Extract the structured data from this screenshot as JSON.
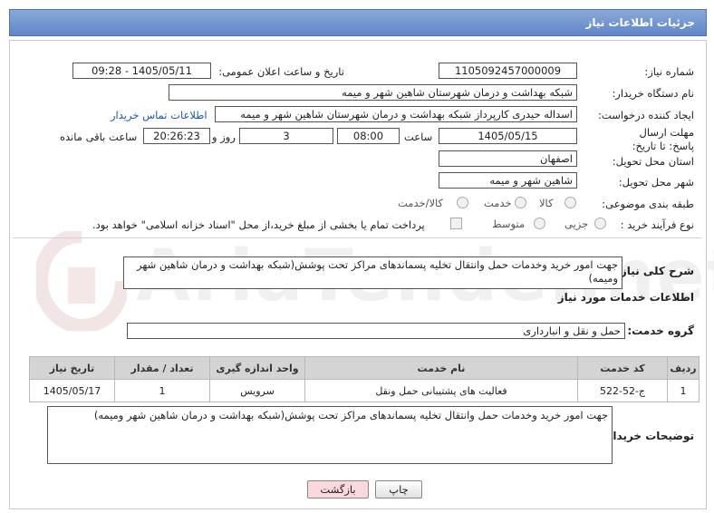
{
  "header": {
    "title": "جزئیات اطلاعات نیاز"
  },
  "fields": {
    "need_number_label": "شماره نیاز:",
    "need_number": "1105092457000009",
    "announce_label": "تاریخ و ساعت اعلان عمومی:",
    "announce_value": "1405/05/11 - 09:28",
    "buyer_org_label": "نام دستگاه خریدار:",
    "buyer_org": "شبکه بهداشت و درمان شهرستان شاهین شهر و میمه",
    "creator_label": "ایجاد کننده درخواست:",
    "creator": "اسداله حیدری کارپرداز شبکه بهداشت و درمان شهرستان شاهین شهر و میمه",
    "contact_link": "اطلاعات تماس خریدار",
    "deadline_label": "مهلت ارسال پاسخ: تا تاریخ:",
    "deadline_date": "1405/05/15",
    "time_label": "ساعت",
    "deadline_time": "08:00",
    "days_value": "3",
    "days_label": "روز و",
    "remaining_time": "20:26:23",
    "remaining_label": "ساعت باقی مانده",
    "province_label": "استان محل تحویل:",
    "province": "اصفهان",
    "city_label": "شهر محل تحویل:",
    "city": "شاهین شهر و میمه",
    "category_label": "طبقه بندی موضوعی:",
    "category_options": [
      "کالا",
      "خدمت",
      "کالا/خدمت"
    ],
    "process_label": "نوع فرآیند خرید :",
    "process_options": [
      "جزیی",
      "متوسط"
    ],
    "payment_note": "پرداخت تمام یا بخشی از مبلغ خرید،از محل \"اسناد خزانه اسلامی\" خواهد بود."
  },
  "summary": {
    "label": "شرح کلی نیاز:",
    "text": "جهت امور خرید وخدمات حمل وانتقال تخلیه پسماندهای مراکز تحت پوشش(شبکه بهداشت و درمان شاهین شهر ومیمه)"
  },
  "services": {
    "section_title": "اطلاعات خدمات مورد نیاز",
    "group_label": "گروه خدمت:",
    "group_value": "حمل و نقل و انبارداری",
    "columns": [
      "ردیف",
      "کد خدمت",
      "نام خدمت",
      "واحد اندازه گیری",
      "تعداد / مقدار",
      "تاریخ نیاز"
    ],
    "rows": [
      [
        "1",
        "ج-52-522",
        "فعالیت های پشتیبانی حمل ونقل",
        "سرویس",
        "1",
        "1405/05/17"
      ]
    ]
  },
  "buyer_notes": {
    "label": "توضیحات خریدار:",
    "text": "جهت امور خرید وخدمات حمل وانتقال تخلیه پسماندهای مراکز تحت پوشش(شبکه بهداشت و درمان شاهین شهر ومیمه)"
  },
  "buttons": {
    "print": "چاپ",
    "back": "بازگشت"
  },
  "watermark": "AriaTender.net",
  "colors": {
    "header": "#6f93cf",
    "link": "#1a57b8",
    "back_button_bg": "#f9d9dc"
  }
}
